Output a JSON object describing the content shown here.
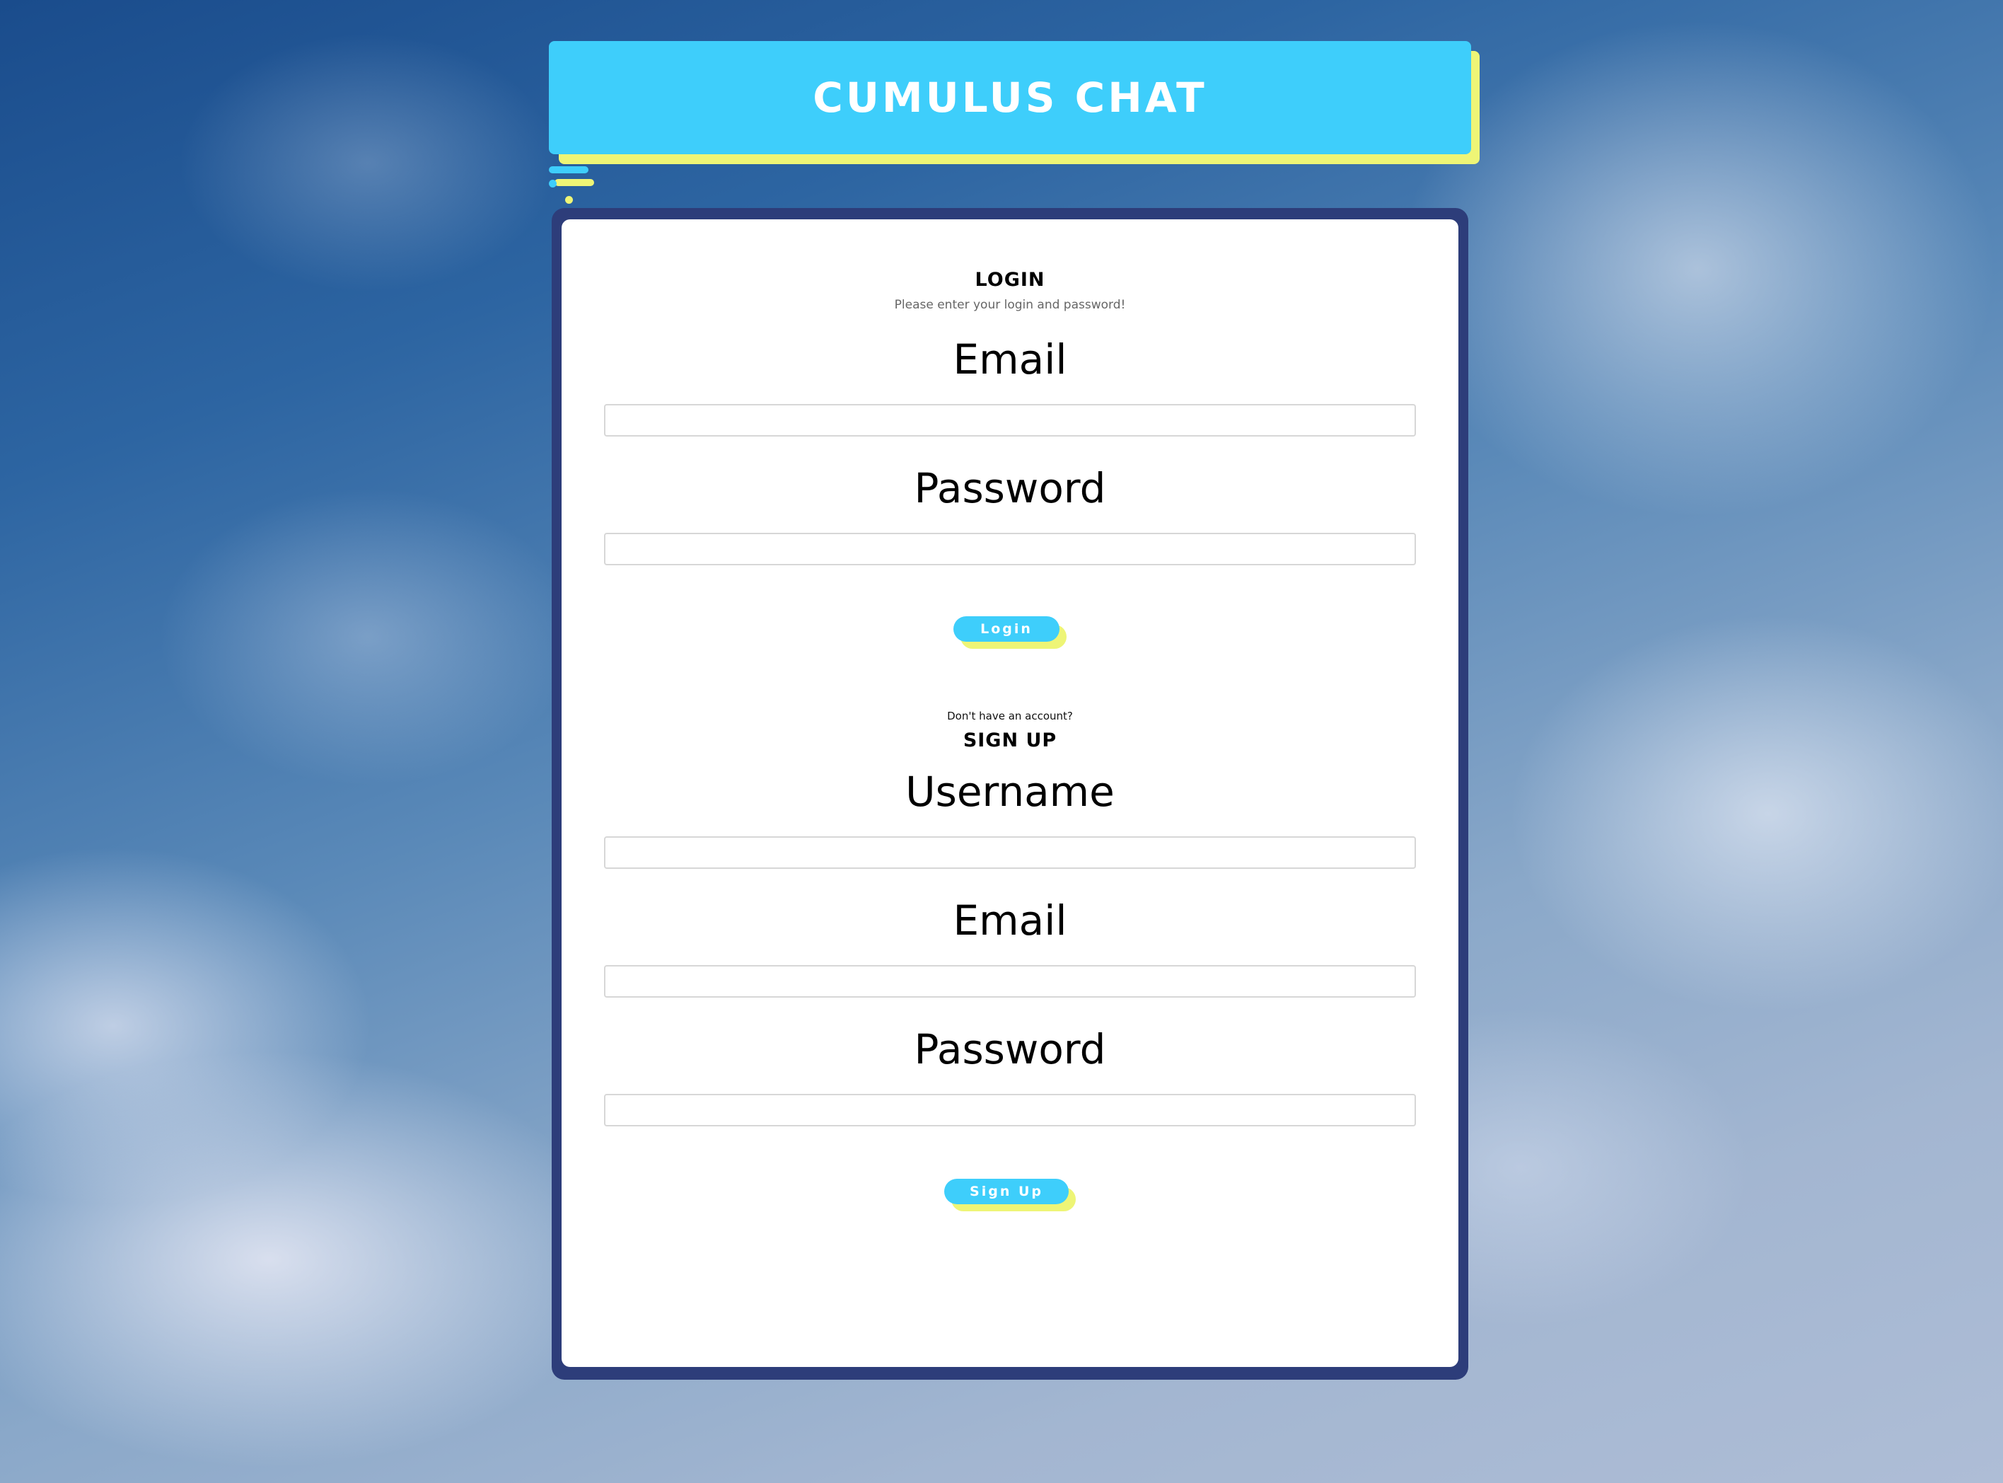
{
  "header": {
    "title": "CUMULUS CHAT"
  },
  "login": {
    "heading": "LOGIN",
    "subtitle": "Please enter your login and password!",
    "email_label": "Email",
    "email_value": "",
    "password_label": "Password",
    "password_value": "",
    "button_label": "Login"
  },
  "signup": {
    "prompt": "Don't have an account?",
    "heading": "SIGN UP",
    "username_label": "Username",
    "username_value": "",
    "email_label": "Email",
    "email_value": "",
    "password_label": "Password",
    "password_value": "",
    "button_label": "Sign Up"
  },
  "colors": {
    "accent_blue": "#3ecefb",
    "accent_yellow": "#eef576",
    "card_border": "#2d3d7a"
  }
}
